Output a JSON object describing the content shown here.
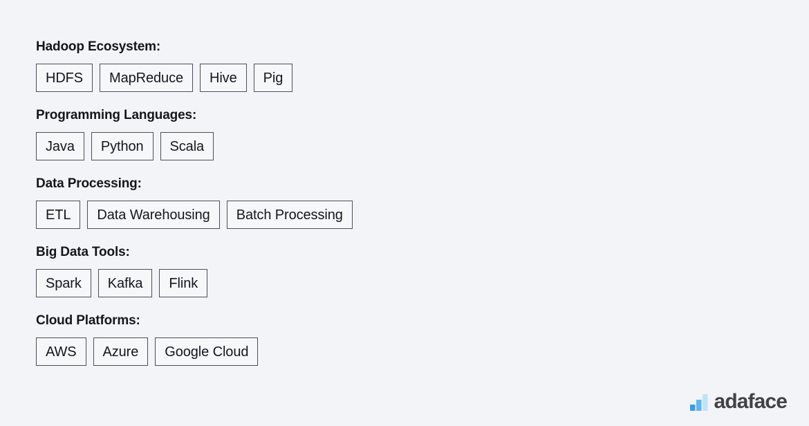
{
  "page": {
    "background_color": "#f2f4f7",
    "text_color": "#14161a"
  },
  "skills": {
    "sections": [
      {
        "heading": "Hadoop Ecosystem:",
        "tags": [
          "HDFS",
          "MapReduce",
          "Hive",
          "Pig"
        ]
      },
      {
        "heading": "Programming Languages:",
        "tags": [
          "Java",
          "Python",
          "Scala"
        ]
      },
      {
        "heading": "Data Processing:",
        "tags": [
          "ETL",
          "Data Warehousing",
          "Batch Processing"
        ]
      },
      {
        "heading": "Big Data Tools:",
        "tags": [
          "Spark",
          "Kafka",
          "Flink"
        ]
      },
      {
        "heading": "Cloud Platforms:",
        "tags": [
          "AWS",
          "Azure",
          "Google Cloud"
        ]
      }
    ]
  },
  "brand": {
    "name": "adaface",
    "icon": "bar-chart-icon",
    "text_color": "#3f4246",
    "bar_colors": [
      "#3c9bea",
      "#5bb8f5",
      "#bfe3f7"
    ]
  }
}
